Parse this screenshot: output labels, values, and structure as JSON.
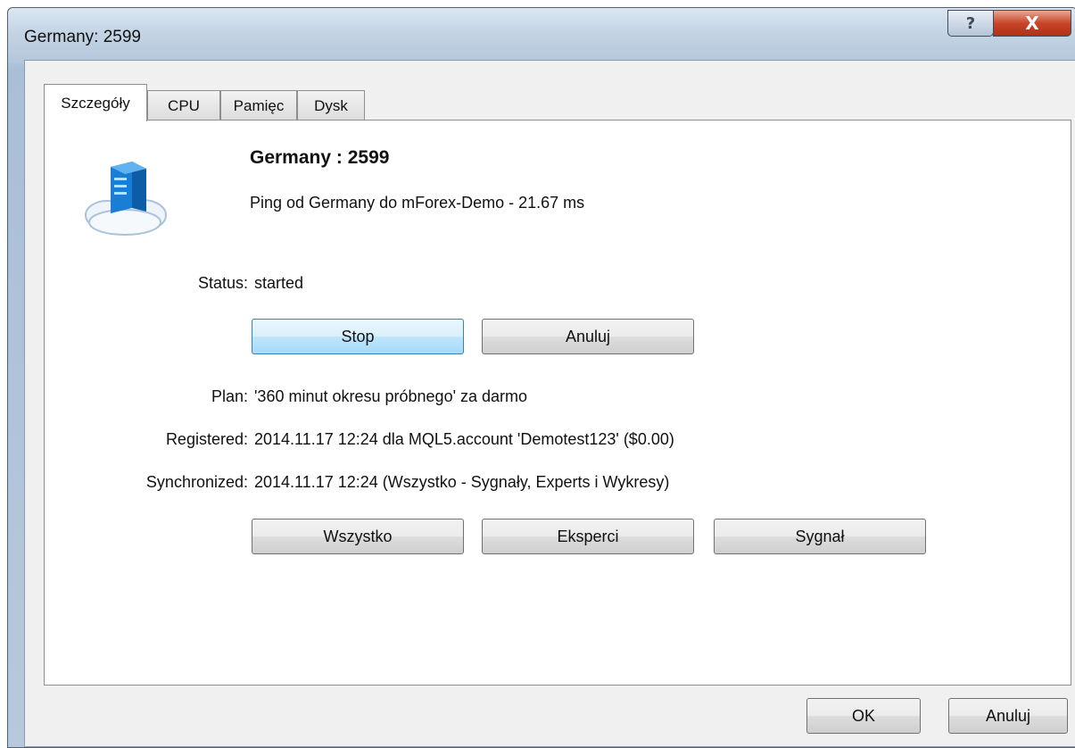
{
  "window": {
    "title": "Germany: 2599",
    "help_label": "?",
    "close_label": "X"
  },
  "tabs": [
    {
      "label": "Szczegóły"
    },
    {
      "label": "CPU"
    },
    {
      "label": "Pamięc"
    },
    {
      "label": "Dysk"
    }
  ],
  "details": {
    "server_title": "Germany : 2599",
    "ping_text": "Ping od Germany do mForex-Demo - 21.67 ms",
    "status_label": "Status:",
    "status_value": "started",
    "stop_button": "Stop",
    "cancel_button": "Anuluj",
    "plan_label": "Plan:",
    "plan_value": "'360 minut okresu próbnego' za darmo",
    "registered_label": "Registered:",
    "registered_value": "2014.11.17 12:24 dla MQL5.account 'Demotest123' ($0.00)",
    "synchronized_label": "Synchronized:",
    "synchronized_value": "2014.11.17 12:24 (Wszystko - Sygnały, Experts i Wykresy)",
    "all_button": "Wszystko",
    "experts_button": "Eksperci",
    "signal_button": "Sygnał"
  },
  "footer": {
    "ok_button": "OK",
    "cancel_button": "Anuluj"
  },
  "icons": {
    "server": "cloud-server-icon"
  },
  "colors": {
    "focus_border": "#3c7fb1",
    "close_red": "#c7452a"
  }
}
